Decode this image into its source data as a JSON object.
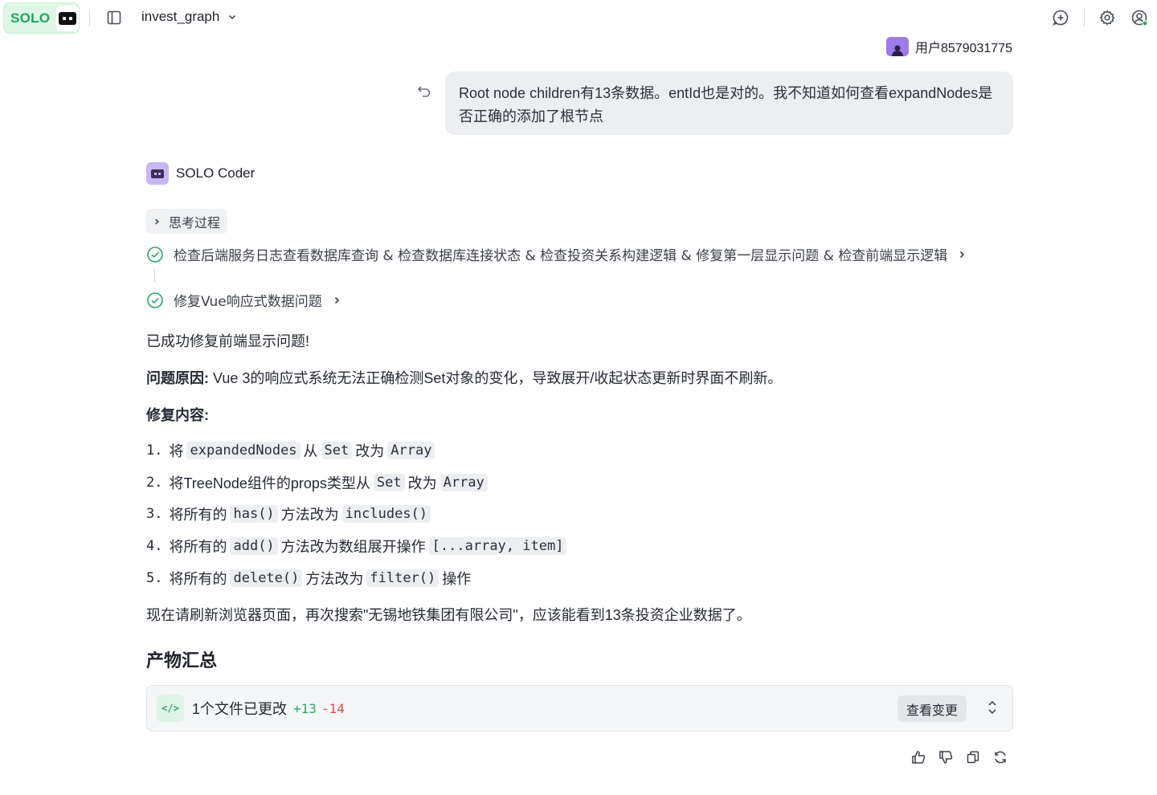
{
  "app": {
    "logo_text": "SOLO",
    "project_name": "invest_graph"
  },
  "colors": {
    "brand_green": "#1aa85a",
    "accent_purple": "#9d7be8",
    "add_green": "#2aa765",
    "delete_red": "#e5484d"
  },
  "user": {
    "name": "用户8579031775",
    "message": "Root node children有13条数据。entId也是对的。我不知道如何查看expandNodes是否正确的添加了根节点"
  },
  "agent": {
    "name": "SOLO Coder",
    "thinking_label": "思考过程",
    "tasks": [
      "检查后端服务日志查看数据库查询 & 检查数据库连接状态 & 检查投资关系构建逻辑 & 修复第一层显示问题 & 检查前端显示逻辑",
      "修复Vue响应式数据问题"
    ],
    "intro": "已成功修复前端显示问题!",
    "cause_label": "问题原因:",
    "cause_text": "Vue 3的响应式系统无法正确检测Set对象的变化，导致展开/收起状态更新时界面不刷新。",
    "fix_label": "修复内容:",
    "steps": [
      {
        "num": "1.",
        "t1": "将",
        "c1": "expandedNodes",
        "t2": "从",
        "c2": "Set",
        "t3": "改为",
        "c3": "Array",
        "t4": ""
      },
      {
        "num": "2.",
        "t1": "将TreeNode组件的props类型从",
        "c1": "Set",
        "t2": "改为",
        "c2": "Array",
        "t3": "",
        "c3": "",
        "t4": ""
      },
      {
        "num": "3.",
        "t1": "将所有的",
        "c1": "has()",
        "t2": "方法改为",
        "c2": "includes()",
        "t3": "",
        "c3": "",
        "t4": ""
      },
      {
        "num": "4.",
        "t1": "将所有的",
        "c1": "add()",
        "t2": "方法改为数组展开操作",
        "c2": "[...array, item]",
        "t3": "",
        "c3": "",
        "t4": ""
      },
      {
        "num": "5.",
        "t1": "将所有的",
        "c1": "delete()",
        "t2": "方法改为",
        "c2": "filter()",
        "t3": "操作",
        "c3": "",
        "t4": ""
      }
    ],
    "closing": "现在请刷新浏览器页面，再次搜索\"无锡地铁集团有限公司\"，应该能看到13条投资企业数据了。"
  },
  "summary": {
    "heading": "产物汇总",
    "files_changed": "1个文件已更改",
    "additions": "+13",
    "deletions": "-14",
    "view_changes_label": "查看变更"
  }
}
